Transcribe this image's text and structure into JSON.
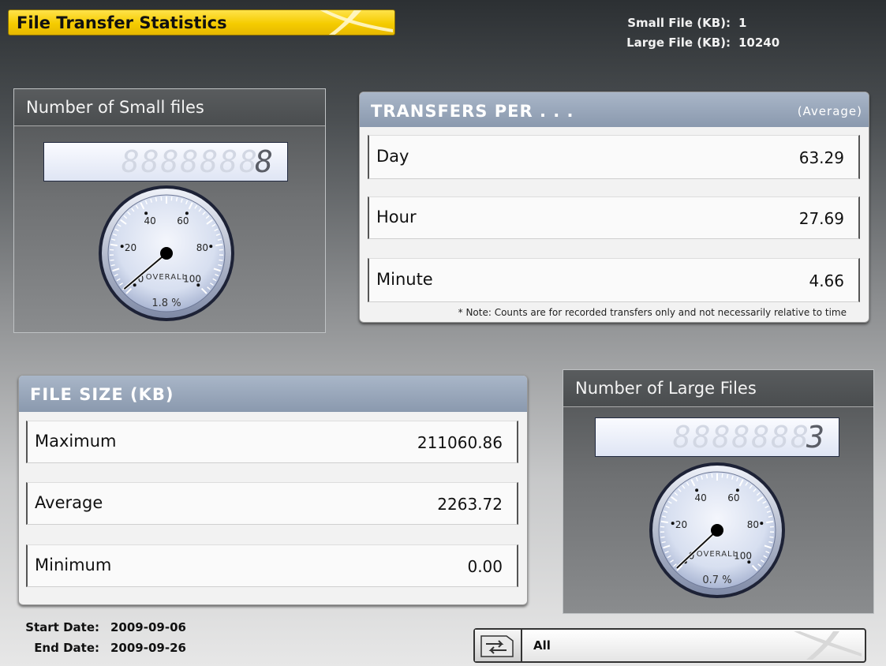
{
  "header": {
    "title": "File Transfer Statistics",
    "small_file_label": "Small File (KB):",
    "small_file_value": "1",
    "large_file_label": "Large File (KB):",
    "large_file_value": "10240"
  },
  "small_files": {
    "title": "Number of Small files",
    "lcd_ghost": "8888888",
    "lcd_value": "8",
    "gauge": {
      "ticks": [
        "0",
        "20",
        "40",
        "60",
        "80",
        "100"
      ],
      "label": "OVERALL",
      "percent": 1.8,
      "percent_text": "1.8 %"
    }
  },
  "large_files": {
    "title": "Number of Large Files",
    "lcd_ghost": "8888888",
    "lcd_value": "3",
    "gauge": {
      "ticks": [
        "0",
        "20",
        "40",
        "60",
        "80",
        "100"
      ],
      "label": "OVERALL",
      "percent": 0.7,
      "percent_text": "0.7 %"
    }
  },
  "transfers": {
    "title": "TRANSFERS PER . . .",
    "subtitle": "(Average)",
    "rows": [
      {
        "label": "Day",
        "value": "63.29"
      },
      {
        "label": "Hour",
        "value": "27.69"
      },
      {
        "label": "Minute",
        "value": "4.66"
      }
    ],
    "note": "* Note: Counts are for recorded transfers only and not necessarily relative to time"
  },
  "file_size": {
    "title": "FILE SIZE (KB)",
    "rows": [
      {
        "label": "Maximum",
        "value": "211060.86"
      },
      {
        "label": "Average",
        "value": "2263.72"
      },
      {
        "label": "Minimum",
        "value": "0.00"
      }
    ]
  },
  "dates": {
    "start_label": "Start Date:",
    "start_value": "2009-09-06",
    "end_label": "End Date:",
    "end_value": "2009-09-26"
  },
  "filter": {
    "label": "All",
    "icon": "swap-arrows-folder-icon"
  },
  "colors": {
    "title_yellow": "#f5cc00",
    "card_header": "#8a99ae",
    "gauge_face": "#d7dff0"
  }
}
